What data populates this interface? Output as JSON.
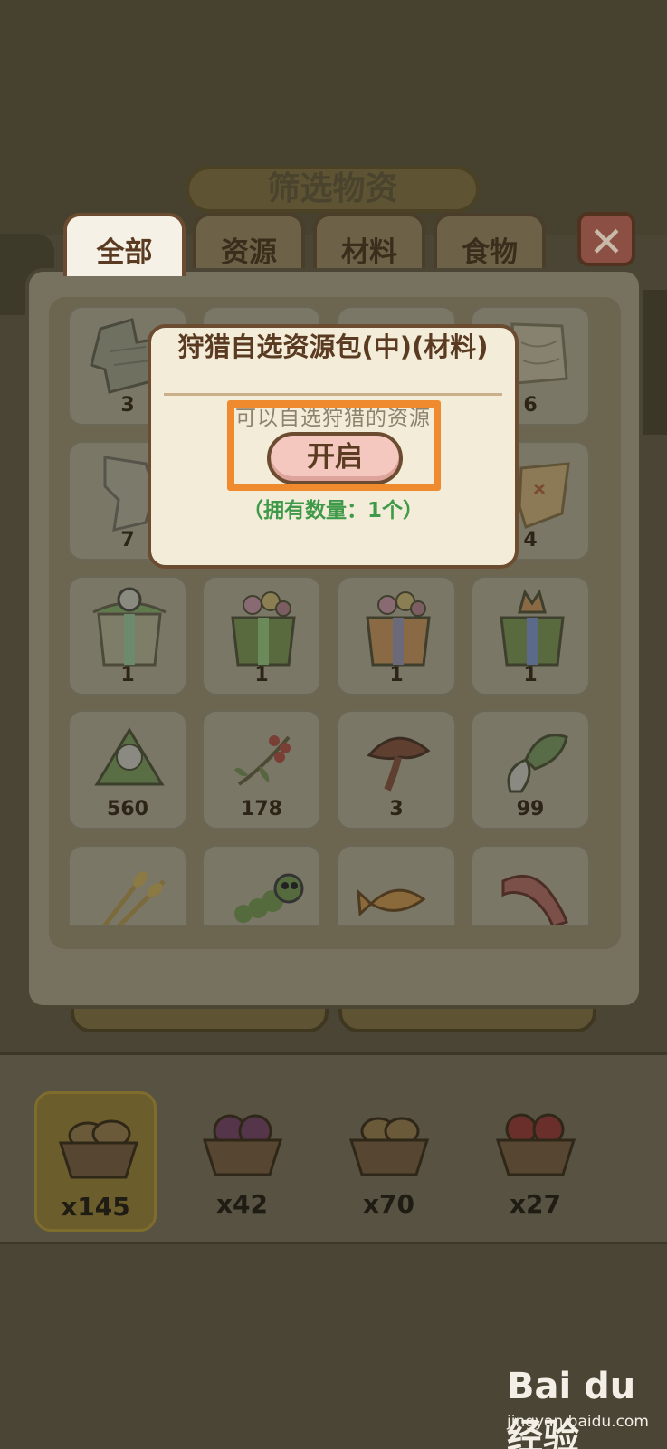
{
  "header": {
    "title": "筛选物资"
  },
  "tabs": [
    {
      "label": "全部",
      "active": true
    },
    {
      "label": "资源",
      "active": false
    },
    {
      "label": "材料",
      "active": false
    },
    {
      "label": "食物",
      "active": false
    }
  ],
  "close_icon": "close-x-icon",
  "items": [
    {
      "icon": "map-scroll-icon",
      "count": "3"
    },
    {
      "icon": "map-scroll-icon",
      "count": ""
    },
    {
      "icon": "map-scroll-icon",
      "count": ""
    },
    {
      "icon": "map-scroll-icon",
      "count": "6"
    },
    {
      "icon": "torn-map-icon",
      "count": "7"
    },
    {
      "icon": "map-scroll-icon",
      "count": ""
    },
    {
      "icon": "map-scroll-icon",
      "count": ""
    },
    {
      "icon": "treasure-map-icon",
      "count": "4"
    },
    {
      "icon": "panda-gift-box-icon",
      "count": "1"
    },
    {
      "icon": "flower-gift-box-icon",
      "count": "1"
    },
    {
      "icon": "flower-gift-box-icon",
      "count": "1"
    },
    {
      "icon": "fox-gift-box-icon",
      "count": "1"
    },
    {
      "icon": "rice-dumpling-icon",
      "count": "560"
    },
    {
      "icon": "berry-branch-icon",
      "count": "178"
    },
    {
      "icon": "mushroom-icon",
      "count": "3"
    },
    {
      "icon": "bok-choy-icon",
      "count": "99"
    },
    {
      "icon": "wheat-icon",
      "count": ""
    },
    {
      "icon": "caterpillar-icon",
      "count": ""
    },
    {
      "icon": "fish-icon",
      "count": ""
    },
    {
      "icon": "bacon-icon",
      "count": ""
    }
  ],
  "popup": {
    "title": "狩猎自选资源包(中)(材料)",
    "description": "可以自选狩猎的资源",
    "open_label": "开启",
    "owned_label": "（拥有数量：1个）"
  },
  "baskets": [
    {
      "icon": "potato-basket-icon",
      "count": "x145",
      "selected": true
    },
    {
      "icon": "cabbage-basket-icon",
      "count": "x42",
      "selected": false
    },
    {
      "icon": "potato-basket-icon",
      "count": "x70",
      "selected": false
    },
    {
      "icon": "apple-basket-icon",
      "count": "x27",
      "selected": false
    }
  ],
  "watermark": {
    "logo": "Bai du 经验",
    "site": "jingyan.baidu.com"
  },
  "colors": {
    "highlight": "#f08a2e",
    "owned_text": "#3e9a48",
    "button_fill": "#f4c7bf"
  }
}
